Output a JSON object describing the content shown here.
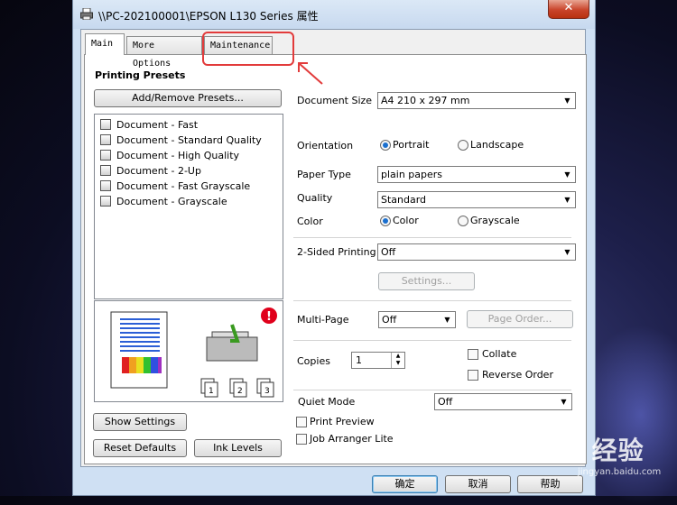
{
  "window": {
    "title": "\\\\PC-202100001\\EPSON L130 Series 属性",
    "close_label": "✕"
  },
  "tabs": [
    {
      "label": "Main"
    },
    {
      "label": "More Options"
    },
    {
      "label": "Maintenance"
    }
  ],
  "presets": {
    "heading": "Printing Presets",
    "add_remove_label": "Add/Remove Presets...",
    "items": [
      "Document - Fast",
      "Document - Standard Quality",
      "Document - High Quality",
      "Document - 2-Up",
      "Document - Fast Grayscale",
      "Document - Grayscale"
    ]
  },
  "settings": {
    "document_size_label": "Document Size",
    "document_size_value": "A4 210 x 297 mm",
    "orientation_label": "Orientation",
    "portrait_label": "Portrait",
    "landscape_label": "Landscape",
    "paper_type_label": "Paper Type",
    "paper_type_value": "plain papers",
    "quality_label": "Quality",
    "quality_value": "Standard",
    "color_label": "Color",
    "color_option_label": "Color",
    "grayscale_label": "Grayscale",
    "two_sided_label": "2-Sided Printing",
    "two_sided_value": "Off",
    "settings_button_label": "Settings...",
    "multi_page_label": "Multi-Page",
    "multi_page_value": "Off",
    "page_order_label": "Page Order...",
    "copies_label": "Copies",
    "copies_value": "1",
    "collate_label": "Collate",
    "reverse_order_label": "Reverse Order",
    "quiet_mode_label": "Quiet Mode",
    "quiet_mode_value": "Off",
    "print_preview_label": "Print Preview",
    "job_arranger_label": "Job Arranger Lite"
  },
  "bottom_left": {
    "show_settings_label": "Show Settings",
    "reset_defaults_label": "Reset Defaults",
    "ink_levels_label": "Ink Levels"
  },
  "dialog_buttons": {
    "ok_label": "确定",
    "cancel_label": "取消",
    "help_label": "帮助"
  },
  "watermark": {
    "text": "Bai 经验",
    "sub": "jingyan.baidu.com"
  },
  "colors": {
    "highlight": "#e23b3b",
    "accent_radio": "#1a6fcf",
    "warning": "#e0001b"
  },
  "icons": [
    "printer-icon",
    "close-icon",
    "warning-icon",
    "arrow-icon",
    "preset-document-icon",
    "chevron-down-icon"
  ]
}
